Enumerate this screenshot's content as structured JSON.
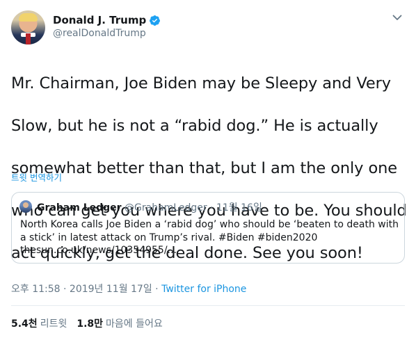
{
  "author": {
    "display_name": "Donald J. Trump",
    "handle": "@realDonaldTrump",
    "verified": true
  },
  "tweet": {
    "text_lines": [
      "Mr. Chairman, Joe Biden may be Sleepy and Very",
      "Slow, but he is not a “rabid dog.” He is actually",
      "somewhat better than that, but I am the only one",
      "who can get you where you have to be. You should",
      "act quickly, get the deal done. See you soon!"
    ],
    "translate_label": "트윗 번역하기"
  },
  "quoted_tweet": {
    "display_name": "Graham Ledger",
    "handle": "@GrahamLedger",
    "separator": " · ",
    "date": "11월 16일",
    "text": "North Korea calls Joe Biden a ‘rabid dog’ who should be ‘beaten to death with a stick’ in latest attack on Trump’s rival. #Biden #biden2020",
    "link": "thesun.co.uk/news/10354955/..."
  },
  "meta": {
    "time": "오후 11:58",
    "separator": " · ",
    "date": "2019년 11월 17일",
    "source": "Twitter for iPhone"
  },
  "stats": {
    "retweets_count": "5.4천",
    "retweets_label": "리트윗",
    "likes_count": "1.8만",
    "likes_label": "마음에 들어요"
  },
  "colors": {
    "accent": "#1b95e0",
    "text": "#14171a",
    "muted": "#657786",
    "border": "#ccd6dd"
  },
  "icons": {
    "verified": "verified-badge-icon",
    "menu": "chevron-down-icon"
  }
}
